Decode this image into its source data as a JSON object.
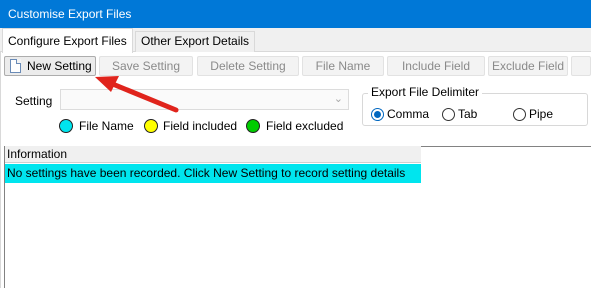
{
  "window": {
    "title": "Customise Export Files"
  },
  "tabs": [
    {
      "label": "Configure Export Files",
      "active": true
    },
    {
      "label": "Other Export Details",
      "active": false
    }
  ],
  "toolbar": {
    "new_setting": "New Setting",
    "save_setting": "Save Setting",
    "delete_setting": "Delete Setting",
    "file_name": "File Name",
    "include_field": "Include Field",
    "exclude_field": "Exclude Field"
  },
  "setting": {
    "label": "Setting",
    "value": ""
  },
  "legend": [
    {
      "label": "File Name",
      "color": "#00e5ee"
    },
    {
      "label": "Field included",
      "color": "#ffff00"
    },
    {
      "label": "Field excluded",
      "color": "#00cc00"
    }
  ],
  "delimiter": {
    "title": "Export File Delimiter",
    "options": [
      {
        "label": "Comma",
        "checked": true
      },
      {
        "label": "Tab",
        "checked": false
      },
      {
        "label": "Pipe",
        "checked": false
      }
    ]
  },
  "information": {
    "header": "Information",
    "row": "No settings have been recorded. Click New Setting to record setting details"
  },
  "colors": {
    "titlebar": "#0078d7",
    "highlight": "#00e5ee",
    "arrow": "#e0241c",
    "radio_checked": "#0067c0"
  },
  "icons": {
    "new_setting": "new-document-icon",
    "select_chevron": "chevron-down-icon"
  }
}
